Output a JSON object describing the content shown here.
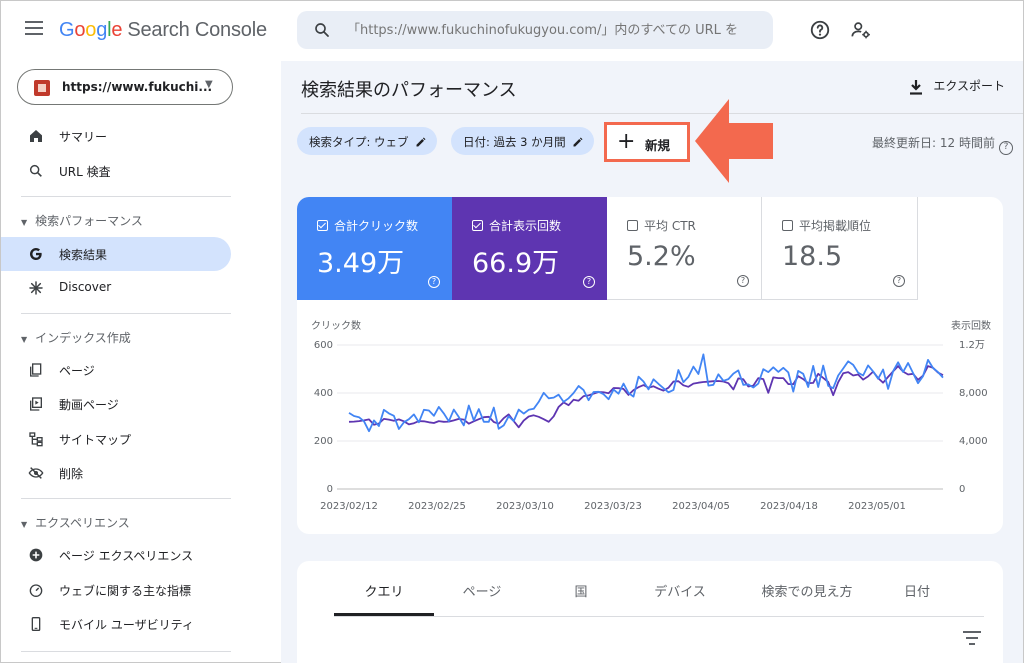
{
  "app": {
    "logo": {
      "g": "G",
      "o1": "o",
      "o2": "o",
      "g2": "g",
      "l": "l",
      "e": "e",
      "product": "Search Console"
    },
    "search_placeholder": "「https://www.fukuchinofukugyou.com/」内のすべての URL を"
  },
  "property": {
    "label": "https://www.fukuchi..."
  },
  "sidebar": {
    "items": [
      {
        "label": "サマリー",
        "icon": "home-icon"
      },
      {
        "label": "URL 検査",
        "icon": "search-icon"
      }
    ],
    "section_performance": "検索パフォーマンス",
    "performance_items": [
      {
        "label": "検索結果",
        "icon": "google-g-icon",
        "active": true
      },
      {
        "label": "Discover",
        "icon": "asterisk-icon"
      }
    ],
    "section_index": "インデックス作成",
    "index_items": [
      {
        "label": "ページ",
        "icon": "pages-icon"
      },
      {
        "label": "動画ページ",
        "icon": "video-icon"
      },
      {
        "label": "サイトマップ",
        "icon": "sitemap-icon"
      },
      {
        "label": "削除",
        "icon": "eye-off-icon"
      }
    ],
    "section_experience": "エクスペリエンス",
    "experience_items": [
      {
        "label": "ページ エクスペリエンス",
        "icon": "plus-circle-icon"
      },
      {
        "label": "ウェブに関する主な指標",
        "icon": "gauge-icon"
      },
      {
        "label": "モバイル ユーザビリティ",
        "icon": "phone-icon"
      }
    ]
  },
  "main": {
    "title": "検索結果のパフォーマンス",
    "export_label": "エクスポート",
    "filters": [
      {
        "label": "検索タイプ: ウェブ"
      },
      {
        "label": "日付: 過去 3 か月間"
      }
    ],
    "new_label": "新規",
    "plus": "+",
    "last_updated": "最終更新日: 12 時間前",
    "help": "?"
  },
  "metrics": [
    {
      "label": "合計クリック数",
      "value": "3.49万",
      "checked": true,
      "color": "#4285f4"
    },
    {
      "label": "合計表示回数",
      "value": "66.9万",
      "checked": true,
      "color": "#5e35b1"
    },
    {
      "label": "平均 CTR",
      "value": "5.2%",
      "checked": false
    },
    {
      "label": "平均掲載順位",
      "value": "18.5",
      "checked": false
    }
  ],
  "chart_data": {
    "type": "line",
    "ylabel_left": "クリック数",
    "ylabel_right": "表示回数",
    "yticks_left": [
      "600",
      "400",
      "200",
      "0"
    ],
    "yticks_right": [
      "1.2万",
      "8,000",
      "4,000",
      "0"
    ],
    "ylim_left": [
      0,
      600
    ],
    "ylim_right": [
      0,
      12000
    ],
    "xticks": [
      "2023/02/12",
      "2023/02/25",
      "2023/03/10",
      "2023/03/23",
      "2023/04/05",
      "2023/04/18",
      "2023/05/01"
    ],
    "series": [
      {
        "name": "合計クリック数",
        "axis": "left",
        "color": "#4285f4",
        "values": [
          317,
          304,
          299,
          282,
          241,
          286,
          262,
          330,
          315,
          305,
          250,
          278,
          291,
          311,
          278,
          330,
          327,
          305,
          342,
          315,
          282,
          331,
          300,
          265,
          348,
          286,
          333,
          280,
          280,
          339,
          251,
          265,
          303,
          283,
          331,
          314,
          330,
          334,
          363,
          401,
          378,
          381,
          393,
          363,
          378,
          400,
          429,
          412,
          370,
          404,
          405,
          395,
          374,
          414,
          397,
          439,
          400,
          385,
          468,
          448,
          415,
          457,
          438,
          420,
          403,
          413,
          496,
          445,
          467,
          510,
          479,
          561,
          431,
          434,
          478,
          451,
          458,
          481,
          494,
          434,
          436,
          423,
          439,
          499,
          487,
          507,
          488,
          505,
          486,
          406,
          492,
          480,
          425,
          513,
          425,
          514,
          430,
          420,
          473,
          502,
          532,
          517,
          485,
          473,
          515,
          490,
          459,
          498,
          417,
          491,
          528,
          488,
          525,
          483,
          441,
          470,
          538,
          504,
          487,
          464
        ]
      },
      {
        "name": "合計表示回数",
        "axis": "left",
        "color": "#5e35b1",
        "values": [
          280,
          281,
          283,
          286,
          290,
          268,
          273,
          292,
          289,
          284,
          290,
          282,
          269,
          274,
          283,
          282,
          278,
          275,
          283,
          280,
          281,
          286,
          292,
          289,
          272,
          282,
          291,
          299,
          301,
          279,
          272,
          295,
          311,
          283,
          257,
          285,
          302,
          307,
          301,
          291,
          280,
          303,
          342,
          361,
          349,
          372,
          368,
          387,
          390,
          397,
          404,
          403,
          399,
          421,
          420,
          417,
          392,
          412,
          424,
          433,
          422,
          428,
          418,
          410,
          422,
          448,
          449,
          432,
          426,
          439,
          443,
          446,
          447,
          449,
          450,
          448,
          441,
          415,
          461,
          457,
          427,
          431,
          462,
          458,
          401,
          465,
          462,
          462,
          437,
          437,
          470,
          458,
          441,
          442,
          480,
          463,
          446,
          391,
          445,
          482,
          487,
          473,
          477,
          456,
          469,
          489,
          462,
          443,
          467,
          490,
          512,
          489,
          477,
          480,
          455,
          472,
          512,
          505,
          485,
          474
        ]
      }
    ]
  },
  "tabs": [
    "クエリ",
    "ページ",
    "国",
    "デバイス",
    "検索での見え方",
    "日付"
  ]
}
